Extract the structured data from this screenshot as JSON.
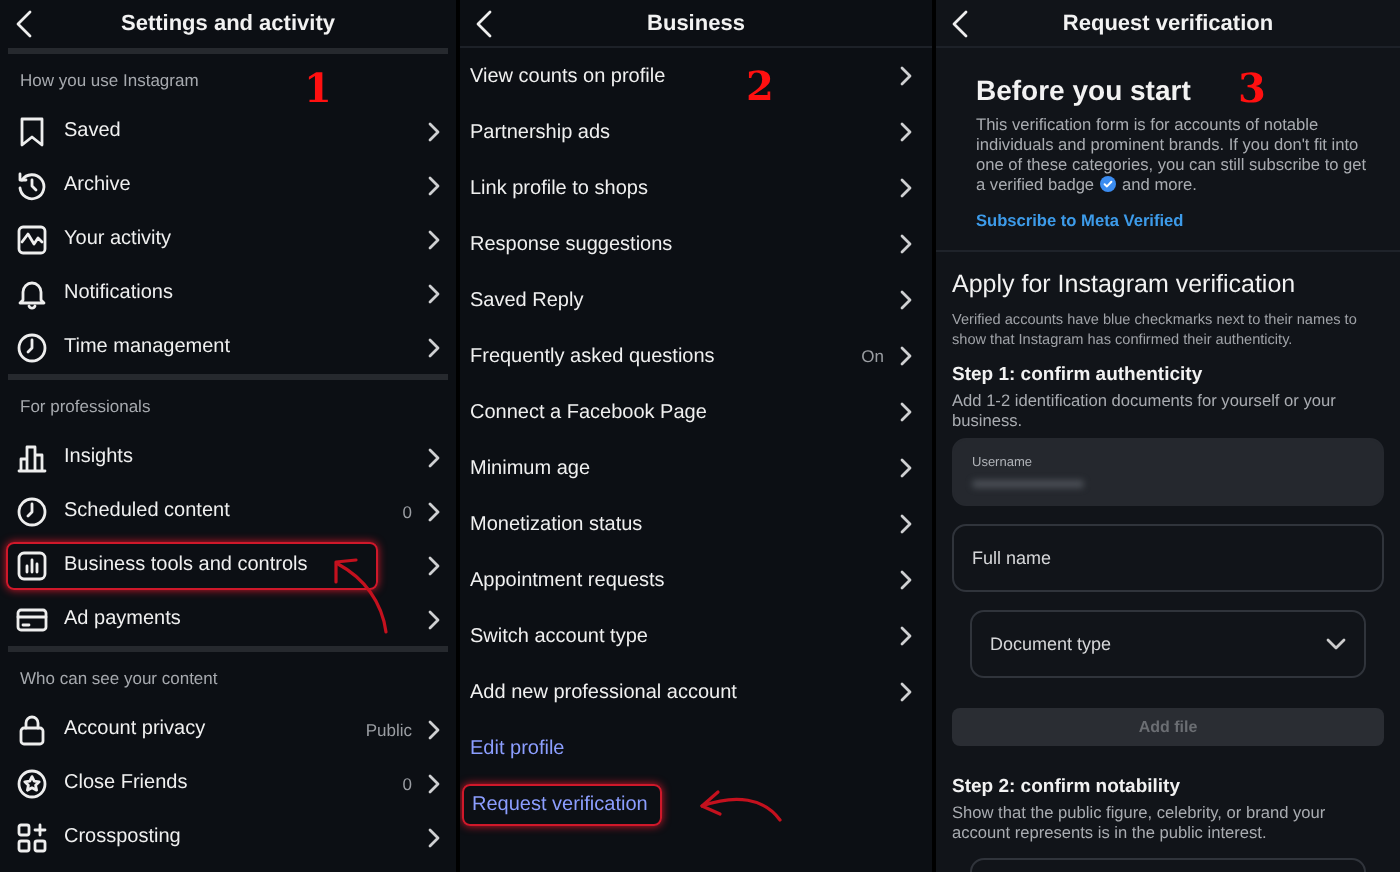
{
  "settings_screen": {
    "title": "Settings and activity",
    "marker": "1",
    "sections": [
      {
        "heading": "How you use Instagram",
        "items": [
          {
            "label": "Saved",
            "highlighted": false
          },
          {
            "label": "Archive",
            "highlighted": false
          },
          {
            "label": "Your activity",
            "highlighted": false
          },
          {
            "label": "Notifications",
            "highlighted": false
          },
          {
            "label": "Time management",
            "highlighted": false
          }
        ]
      },
      {
        "heading": "For professionals",
        "items": [
          {
            "label": "Insights",
            "highlighted": false
          },
          {
            "label": "Scheduled content",
            "value": "0",
            "highlighted": false
          },
          {
            "label": "Business tools and controls",
            "highlighted": true
          },
          {
            "label": "Ad payments",
            "highlighted": false
          }
        ]
      },
      {
        "heading": "Who can see your content",
        "items": [
          {
            "label": "Account privacy",
            "value": "Public",
            "highlighted": false
          },
          {
            "label": "Close Friends",
            "value": "0",
            "highlighted": false
          },
          {
            "label": "Crossposting",
            "highlighted": false
          }
        ]
      }
    ]
  },
  "business_screen": {
    "title": "Business",
    "marker": "2",
    "items": [
      {
        "label": "View counts on profile",
        "kind": "nav",
        "highlighted": false
      },
      {
        "label": "Partnership ads",
        "kind": "nav",
        "highlighted": false
      },
      {
        "label": "Link profile to shops",
        "kind": "nav",
        "highlighted": false
      },
      {
        "label": "Response suggestions",
        "kind": "nav",
        "highlighted": false
      },
      {
        "label": "Saved Reply",
        "kind": "nav",
        "highlighted": false
      },
      {
        "label": "Frequently asked questions",
        "value": "On",
        "kind": "nav",
        "highlighted": false
      },
      {
        "label": "Connect a Facebook Page",
        "kind": "nav",
        "highlighted": false
      },
      {
        "label": "Minimum age",
        "kind": "nav",
        "highlighted": false
      },
      {
        "label": "Monetization status",
        "kind": "nav",
        "highlighted": false
      },
      {
        "label": "Appointment requests",
        "kind": "nav",
        "highlighted": false
      },
      {
        "label": "Switch account type",
        "kind": "nav",
        "highlighted": false
      },
      {
        "label": "Add new professional account",
        "kind": "nav",
        "highlighted": false
      },
      {
        "label": "Edit profile",
        "kind": "link",
        "highlighted": false
      },
      {
        "label": "Request verification",
        "kind": "link",
        "highlighted": true
      }
    ]
  },
  "verification_screen": {
    "title": "Request verification",
    "marker": "3",
    "intro": {
      "heading": "Before you start",
      "text": "This verification form is for accounts of notable individuals and prominent brands. If you don't fit into one of these categories, you can still subscribe to get",
      "text_before": "a verified badge",
      "text_after": "and more.",
      "link": "Subscribe to Meta Verified"
    },
    "heading": "Apply for Instagram verification",
    "description": "Verified accounts have blue checkmarks next to their names to show that Instagram has confirmed their authenticity.",
    "steps": [
      {
        "title": "Step 1: confirm authenticity",
        "text": "Add 1-2 identification documents for yourself or your business.",
        "fields": [
          {
            "kind": "filled",
            "label": "Username"
          },
          {
            "kind": "input",
            "placeholder": "Full name"
          },
          {
            "kind": "select",
            "placeholder": "Document type"
          },
          {
            "kind": "button",
            "label": "Add file",
            "disabled": true
          }
        ]
      },
      {
        "title": "Step 2: confirm notability",
        "text": "Show that the public figure, celebrity, or brand your account represents is in the public interest.",
        "fields": [
          {
            "kind": "input"
          }
        ]
      }
    ]
  }
}
